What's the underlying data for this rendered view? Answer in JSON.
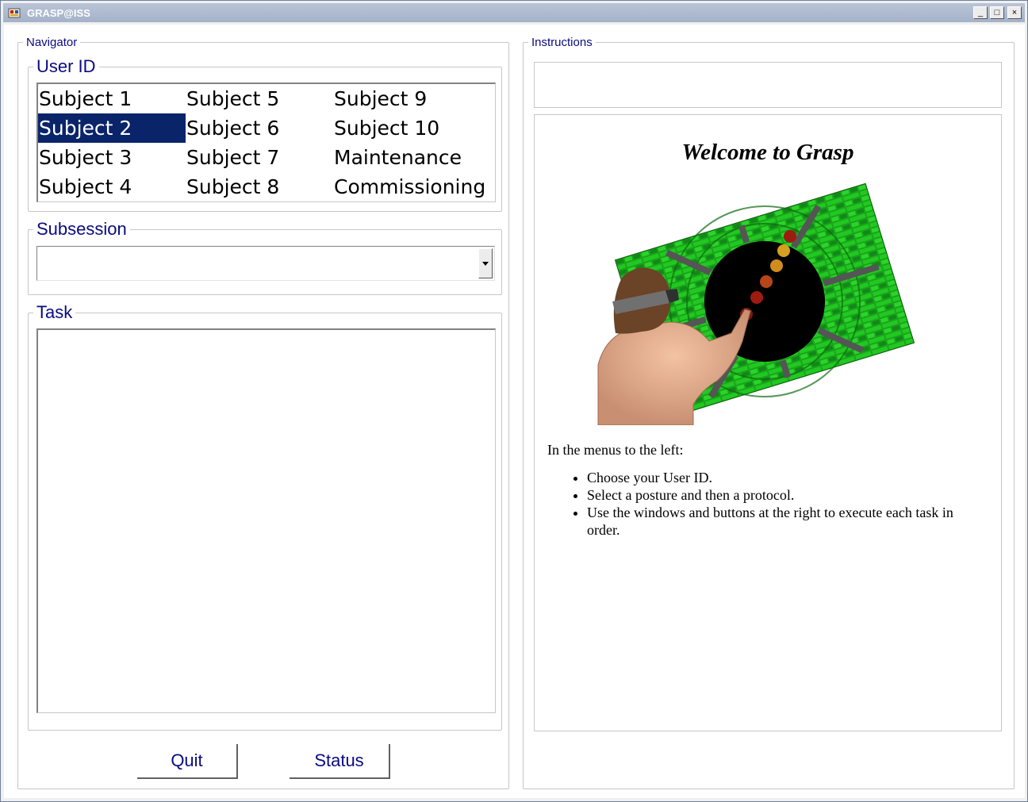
{
  "window": {
    "title": "GRASP@ISS",
    "controls": {
      "minimize": "_",
      "maximize": "□",
      "close": "×"
    }
  },
  "navigator": {
    "legend": "Navigator",
    "user_id": {
      "legend": "User ID",
      "items": [
        "Subject 1",
        "Subject 2",
        "Subject 3",
        "Subject 4",
        "Subject 5",
        "Subject 6",
        "Subject 7",
        "Subject 8",
        "Subject 9",
        "Subject 10",
        "Maintenance",
        "Commissioning"
      ],
      "selected": "Subject 2"
    },
    "subsession": {
      "legend": "Subsession",
      "value": ""
    },
    "task": {
      "legend": "Task"
    },
    "buttons": {
      "quit": "Quit",
      "status": "Status"
    }
  },
  "instructions": {
    "legend": "Instructions",
    "welcome": "Welcome to Grasp",
    "intro": "In the menus to the left:",
    "bullets": [
      "Choose your User ID.",
      "Select a posture and then a protocol.",
      "Use the windows and buttons at the right to execute each task in order."
    ]
  },
  "colors": {
    "selection": "#0a246a",
    "legend_text": "#0a0a80",
    "panel_green": "#1fa81f",
    "tunnel_black": "#000000",
    "target_red": "#9e1b10",
    "target_yellow": "#d8a020"
  },
  "icons": [
    "app-icon",
    "minimize-icon",
    "maximize-icon",
    "close-icon",
    "dropdown-arrow-icon"
  ]
}
